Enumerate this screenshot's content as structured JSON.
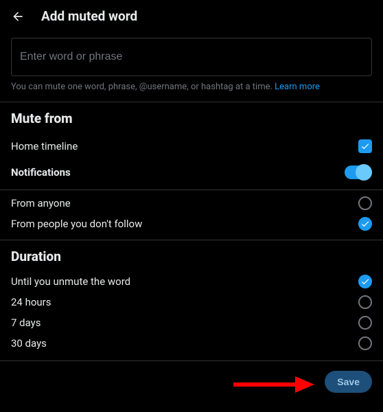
{
  "header": {
    "title": "Add muted word"
  },
  "input": {
    "placeholder": "Enter word or phrase",
    "value": ""
  },
  "help": {
    "text": "You can mute one word, phrase, @username, or hashtag at a time. ",
    "link_text": "Learn more"
  },
  "mute_from": {
    "title": "Mute from",
    "home_timeline_label": "Home timeline",
    "notifications_label": "Notifications"
  },
  "notif_options": {
    "anyone_label": "From anyone",
    "not_follow_label": "From people you don't follow"
  },
  "duration": {
    "title": "Duration",
    "until_unmute_label": "Until you unmute the word",
    "hours24_label": "24 hours",
    "days7_label": "7 days",
    "days30_label": "30 days"
  },
  "footer": {
    "save_label": "Save"
  }
}
